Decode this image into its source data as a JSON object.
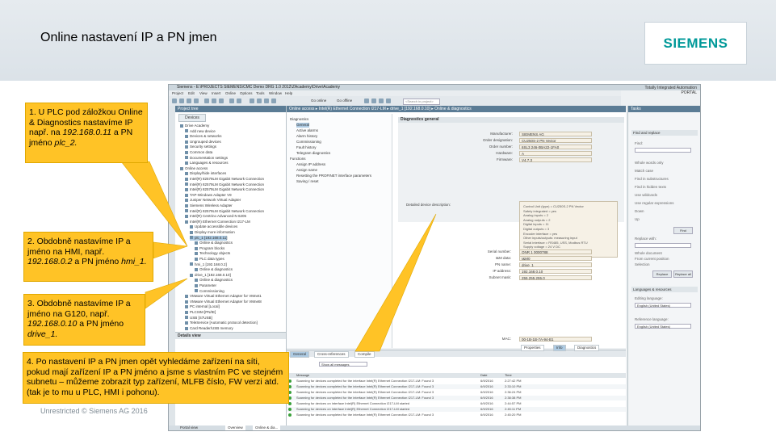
{
  "slide": {
    "title": "Online nastavení IP a PN jmen",
    "logo": "SIEMENS",
    "footer": "Unrestricted © Siemens AG 2016"
  },
  "tia": {
    "window_title": "Siemens - E:\\PROJECTS SIEMENS\\CMC Demo DRG 1.0 2012\\ZAcademy\\Drive\\Academy",
    "brand_line1": "Totally Integrated Automation",
    "brand_line2": "PORTAL",
    "menu": [
      "Project",
      "Edit",
      "View",
      "Insert",
      "Online",
      "Options",
      "Tools",
      "Window",
      "Help"
    ],
    "toolbar": {
      "go_online": "Go online",
      "go_offline": "Go offline",
      "search_placeholder": "<Search in project>"
    },
    "project_tree": {
      "title": "Project tree",
      "devices_tab": "Devices",
      "rows": [
        "Drive Academy",
        "Add new device",
        "Devices & networks",
        "Ungrouped devices",
        "Security settings",
        "Common data",
        "Documentation settings",
        "Languages & resources",
        "Online access",
        "Display/hide interfaces",
        "Intel(R) 82579LM Gigabit Network Connection",
        "Intel(R) 82579LM Gigabit Network Connection",
        "Intel(R) 82579LM Gigabit Network Connection",
        "TAP-Windows Adapter V9",
        "Juniper Network Virtual Adapter",
        "Siemens Wireless Adapter",
        "Intel(R) 82579LM Gigabit Network Connection",
        "Intel(R) Centrino Advanced-N 6205",
        "Intel(R) Ethernet Connection I217-LM",
        "Update accessible devices",
        "Display more information",
        "plc_1 [192.168.0.11]",
        "Online & diagnostics",
        "Program blocks",
        "Technology objects",
        "PLC data types",
        "hmi_1 [192.168.0.2]",
        "Online & diagnostics",
        "drive_1 [192.168.0.10]",
        "Online & diagnostics",
        "Parameter",
        "Commissioning",
        "VMware Virtual Ethernet Adapter for VMnet1",
        "VMware Virtual Ethernet Adapter for VMnet8",
        "PC internal [Local]",
        "PLCSIM [PN/IE]",
        "USB [S7USB]",
        "TeleService [Automatic protocol detection]",
        "Card Reader/USB memory"
      ],
      "details_view": "Details view"
    },
    "editor": {
      "breadcrumb": "Online access ▸ Intel(R) Ethernet Connection I217-LM ▸ drive_1 [192.168.0.10] ▸ Online & diagnostics",
      "nav": [
        "Diagnostics",
        "General",
        "Active alarms",
        "Alarm history",
        "Commissioning",
        "Fault history",
        "Telegram diagnostics",
        "Functions",
        "Assign IP address",
        "Assign name",
        "Resetting the PROFINET interface parameters",
        "Saving / reset"
      ],
      "diag_title": "Diagnostics general",
      "fields": [
        {
          "label": "Manufacturer:",
          "value": "SIEMENS AG"
        },
        {
          "label": "Order designation:",
          "value": "CU250S-2 PN Vector"
        },
        {
          "label": "Order number:",
          "value": "6SL3 246-0BA22-1FA0"
        },
        {
          "label": "Hardware:",
          "value": "A"
        },
        {
          "label": "Firmware:",
          "value": "V4.7.3"
        }
      ],
      "desc_label": "Detailed device description:",
      "desc_lines": [
        "Control Unit (type) = CU250S-2 PN Vector",
        "Safety integrated = yes",
        "Analog inputs = 2",
        "Analog outputs = 2",
        "Digital inputs = 11",
        "Digital outputs = 3",
        "Encoder interface = yes",
        "Other inputs/outputs: measuring input",
        "Serial interface = RS485, USS, Modbus RTU",
        "Supply voltage = 24 V DC",
        "Operating temperature = 0..50 °C"
      ],
      "net_fields": [
        {
          "label": "Serial number:",
          "value": "ONR 1 0000788"
        },
        {
          "label": "I&M data:",
          "value": "I&M0"
        },
        {
          "label": "PN name:",
          "value": "drive_1"
        },
        {
          "label": "IP address:",
          "value": "192.168.0.10"
        },
        {
          "label": "Subnet mask:",
          "value": "255.255.255.0"
        },
        {
          "label": "MAC:",
          "value": "00-1B-1B-7A-94-B1"
        }
      ]
    },
    "tasks": {
      "title": "Tasks",
      "find_replace": "Find and replace",
      "options": [
        "Find:",
        "Whole words only",
        "Match case",
        "Find in substructures",
        "Find in hidden texts",
        "Use wildcards",
        "Use regular expressions",
        "Down",
        "Up"
      ],
      "find_btn": "Find",
      "replace_label": "Replace with:",
      "scope_whole": "Whole document",
      "scope_current": "From current position",
      "scope_selection": "Selection",
      "replace_btn": "Replace",
      "replace_all_btn": "Replace all",
      "languages_title": "Languages & resources",
      "editing_language": "Editing language:",
      "editing_value": "English (United States)",
      "reference_language": "Reference language:",
      "reference_value": "English (United States)"
    },
    "inspector": {
      "tabs": [
        "General",
        "Cross-references",
        "Compile"
      ],
      "right_tabs": [
        "Properties",
        "Info",
        "Diagnostics"
      ],
      "filter": "Show all messages",
      "columns": [
        "Message",
        "Date",
        "Time"
      ],
      "messages": [
        {
          "text": "Scanning for devices completed for the interface Intel(R) Ethernet Connection I217-LM: Found 3",
          "date": "6/9/2016",
          "time": "2:27:42 PM"
        },
        {
          "text": "Scanning for devices completed for the interface Intel(R) Ethernet Connection I217-LM: Found 3",
          "date": "6/9/2016",
          "time": "2:33:10 PM"
        },
        {
          "text": "Scanning for devices completed for the interface Intel(R) Ethernet Connection I217-LM: Found 3",
          "date": "6/9/2016",
          "time": "2:36:24 PM"
        },
        {
          "text": "Scanning for devices completed for the interface Intel(R) Ethernet Connection I217-LM: Found 3",
          "date": "6/9/2016",
          "time": "2:38:38 PM"
        },
        {
          "text": "Scanning for devices on interface Intel(R) Ethernet Connection I217-LM started",
          "date": "6/9/2016",
          "time": "2:44:57 PM"
        },
        {
          "text": "Scanning for devices on interface Intel(R) Ethernet Connection I217-LM started",
          "date": "6/9/2016",
          "time": "2:45:11 PM"
        },
        {
          "text": "Scanning for devices completed for the interface Intel(R) Ethernet Connection I217-LM: Found 3",
          "date": "6/9/2016",
          "time": "2:45:20 PM"
        }
      ]
    },
    "portal_view": "Portal view",
    "taskbar": [
      "Overview",
      "Online & dia..."
    ]
  },
  "callouts": {
    "c1": {
      "line1": "1. U PLC pod záložkou Online & Diagnostics nastavíme IP např. na ",
      "ital": "192.168.0.11",
      "mid": " a PN jméno ",
      "name": "plc_2."
    },
    "c2": {
      "line1": "2. Obdobně nastavíme IP a jméno na HMI, např. ",
      "ital": "192.168.0.2",
      "mid": " a PN jméno ",
      "name": "hmi_1."
    },
    "c3": {
      "line1": "3. Obdobně nastavíme IP a jméno na G120, např. ",
      "ital": "192.168.0.10",
      "mid": " a PN jméno ",
      "name": "drive_1."
    },
    "c4": {
      "text": "4. Po nastavení IP a PN jmen opět vyhledáme zařízení na síti, pokud mají zařízení IP a PN jméno a jsme s vlastním PC ve stejném subnetu – můžeme zobrazit typ zařízení, MLFB číslo, FW verzi atd. (tak je to mu u PLC, HMI i pohonu)."
    }
  },
  "colors": {
    "callout": "#ffc326",
    "accent": "#009999",
    "tia_head": "#5b7c95",
    "header_band": "#dde4ea"
  }
}
